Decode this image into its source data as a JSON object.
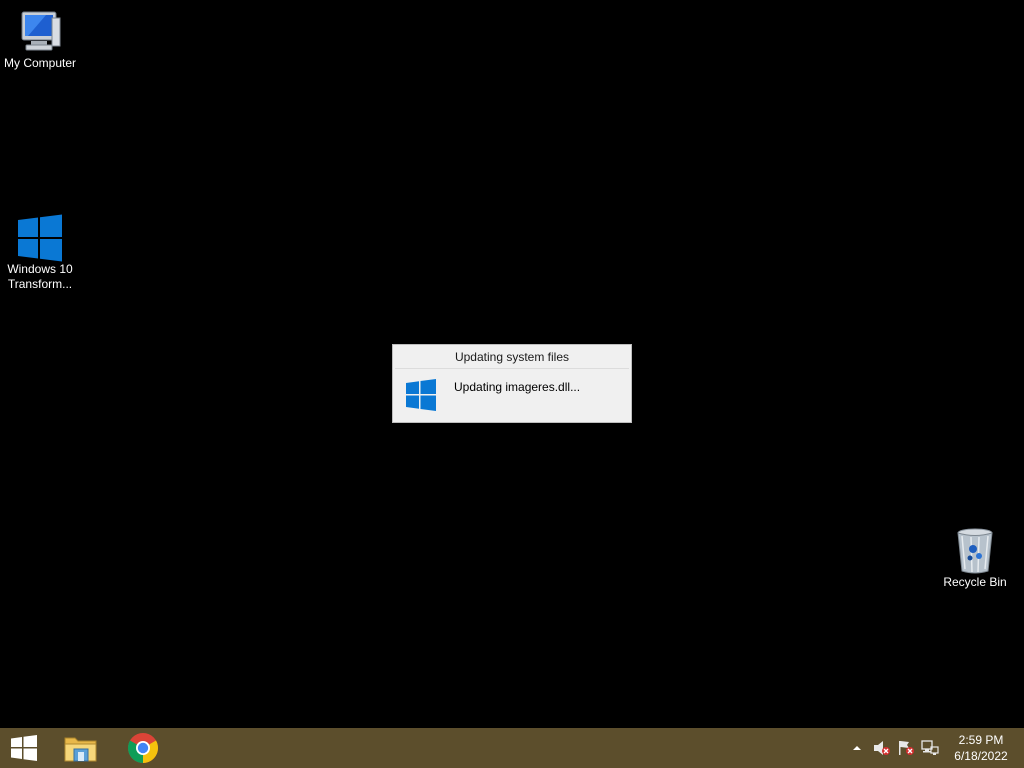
{
  "desktop": {
    "icons": [
      {
        "label": "My Computer",
        "icon": "computer-icon"
      },
      {
        "label_line1": "Windows 10",
        "label_line2": "Transform...",
        "icon": "windows-logo-icon"
      },
      {
        "label": "Recycle Bin",
        "icon": "recycle-bin-icon"
      }
    ]
  },
  "dialog": {
    "title": "Updating system files",
    "message": "Updating imageres.dll...",
    "icon": "windows-logo-icon"
  },
  "taskbar": {
    "pinned": [
      {
        "name": "start",
        "icon": "windows-start-icon"
      },
      {
        "name": "file-explorer",
        "icon": "folder-icon"
      },
      {
        "name": "chrome",
        "icon": "chrome-icon"
      }
    ],
    "tray": {
      "icons": [
        "chevron-up-icon",
        "volume-muted-icon",
        "action-center-flag-icon",
        "network-icon"
      ],
      "time": "2:59 PM",
      "date": "6/18/2022"
    }
  },
  "colors": {
    "desktop_bg": "#000000",
    "taskbar_bg": "#5c4e2c",
    "windows_blue": "#0a78d4",
    "dialog_bg": "#f0f0f0"
  }
}
